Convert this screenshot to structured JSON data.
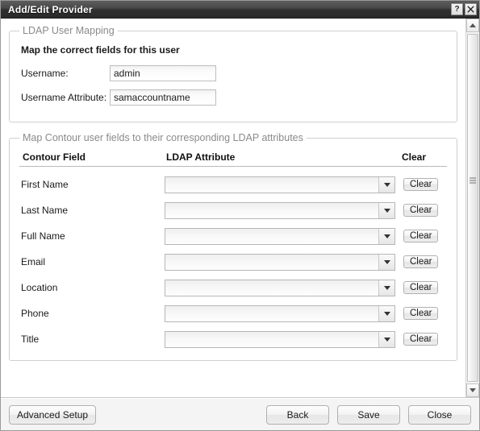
{
  "window": {
    "title": "Add/Edit Provider",
    "help_button_label": "?",
    "close_button_label": "✕",
    "help_icon": "question-mark-icon",
    "close_icon": "close-x-icon"
  },
  "user_mapping": {
    "legend": "LDAP User Mapping",
    "hint": "Map the correct fields for this user",
    "fields": [
      {
        "label": "Username:",
        "value": "admin",
        "placeholder": ""
      },
      {
        "label": "Username Attribute:",
        "value": "samaccountname",
        "placeholder": ""
      }
    ]
  },
  "field_mapping": {
    "legend": "Map Contour user fields to their corresponding LDAP attributes",
    "columns": {
      "field": "Contour Field",
      "attribute": "LDAP Attribute",
      "clear": "Clear"
    },
    "clear_button_label": "Clear",
    "dropdown_icon": "chevron-down-icon",
    "rows": [
      {
        "field": "First Name",
        "attribute": ""
      },
      {
        "field": "Last Name",
        "attribute": ""
      },
      {
        "field": "Full Name",
        "attribute": ""
      },
      {
        "field": "Email",
        "attribute": ""
      },
      {
        "field": "Location",
        "attribute": ""
      },
      {
        "field": "Phone",
        "attribute": ""
      },
      {
        "field": "Title",
        "attribute": ""
      }
    ]
  },
  "footer": {
    "advanced_setup": "Advanced Setup",
    "back": "Back",
    "save": "Save",
    "close": "Close"
  },
  "scrollbar": {
    "up_icon": "scroll-up-arrow-icon",
    "down_icon": "scroll-down-arrow-icon",
    "grip_icon": "scrollbar-grip-icon"
  },
  "colors": {
    "titlebar_dark": "#2a2a2a",
    "titlebar_light": "#5d5d5d",
    "legend_text": "#8a8a8a",
    "border": "#cfcfcf"
  }
}
